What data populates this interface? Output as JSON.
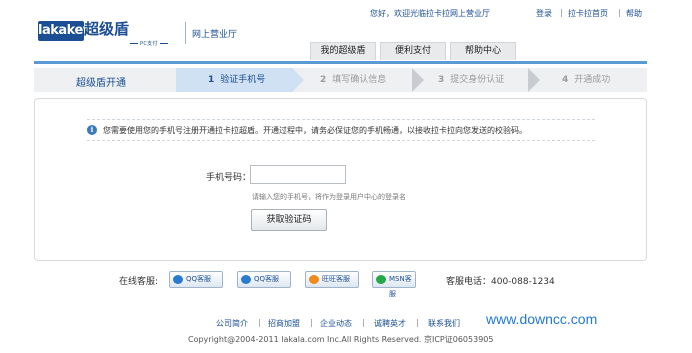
{
  "header": {
    "logo_text": "lakakey",
    "logo_cn": "超级盾",
    "logo_sub": "PC支付",
    "tagline": "网上营业厅",
    "welcome": "您好，欢迎光临拉卡拉网上营业厅",
    "links": [
      "登录",
      "拉卡拉首页",
      "帮助"
    ],
    "link_sep": "|"
  },
  "nav": {
    "tabs": [
      "我的超级盾",
      "便利支付",
      "帮助中心"
    ]
  },
  "steps": {
    "title": "超级盾开通",
    "items": [
      {
        "num": "1",
        "label": "验证手机号"
      },
      {
        "num": "2",
        "label": "填写确认信息"
      },
      {
        "num": "3",
        "label": "提交身份认证"
      },
      {
        "num": "4",
        "label": "开通成功"
      }
    ]
  },
  "notice": {
    "icon": "i",
    "text": "您需要使用您的手机号注册开通拉卡拉超盾。开通过程中，请务必保证您的手机畅通，以接收拉卡拉向您发送的校验码。"
  },
  "form": {
    "phone_label": "手机号码：",
    "phone_value": "",
    "phone_placeholder": "",
    "hint": "请输入您的手机号，将作为登录用户中心的登录名",
    "submit": "获取验证码"
  },
  "service": {
    "label": "在线客服:",
    "buttons": [
      "QQ客服",
      "QQ客服",
      "旺旺客服",
      "MSN客服"
    ],
    "hotline": "客服电话：400-088-1234"
  },
  "footer": {
    "links": [
      "公司简介",
      "招商加盟",
      "企业动态",
      "诚聘英才",
      "联系我们"
    ],
    "sep": "|",
    "copyright": "Copyright@2004-2011 lakala.com Inc.All Rights Reserved. 京ICP证06053905"
  },
  "watermark": "www.downcc.com",
  "colors": {
    "brand": "#1b4e93",
    "accent": "#5a9ad4",
    "active_step": "#cfe1f3"
  }
}
